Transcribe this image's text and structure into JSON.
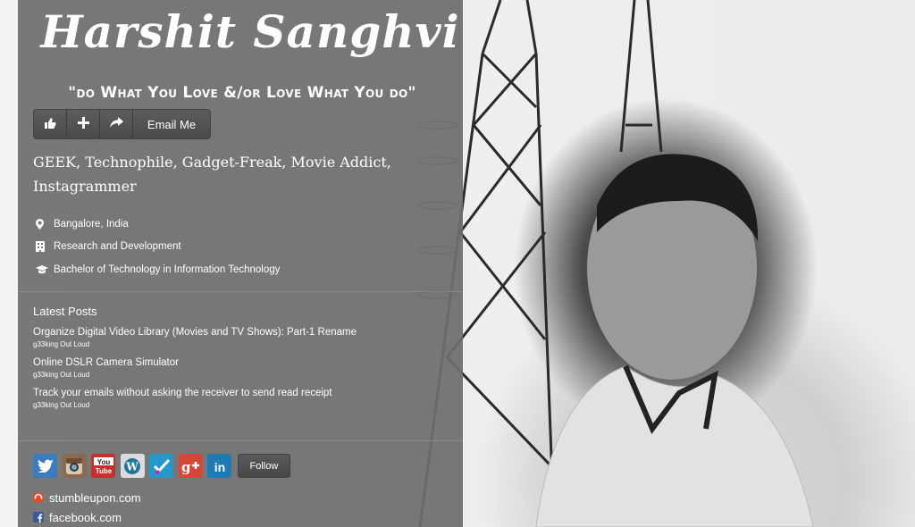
{
  "profile": {
    "name": "Harshit Sanghvi",
    "tagline": "\"do What You Love &/or Love What You do\"",
    "bio": "GEEK, Technophile, Gadget-Freak, Movie Addict, Instagrammer"
  },
  "actions": {
    "like_icon": "thumbs-up-icon",
    "add_icon": "plus-icon",
    "share_icon": "share-arrow-icon",
    "email_label": "Email Me"
  },
  "facts": [
    {
      "icon": "location-pin-icon",
      "text": "Bangalore, India"
    },
    {
      "icon": "building-icon",
      "text": "Research and Development"
    },
    {
      "icon": "graduation-cap-icon",
      "text": "Bachelor of Technology in Information Technology"
    }
  ],
  "latest_posts": {
    "heading": "Latest Posts",
    "items": [
      {
        "title": "Organize Digital Video Library (Movies and TV Shows): Part-1 Rename",
        "source": "g33king Out Loud"
      },
      {
        "title": "Online DSLR Camera Simulator",
        "source": "g33king Out Loud"
      },
      {
        "title": "Track your emails without asking the receiver to send read receipt",
        "source": "g33king Out Loud"
      }
    ]
  },
  "social": {
    "icons": [
      {
        "name": "twitter-icon",
        "glyph": "t",
        "color": "#3b7bbf"
      },
      {
        "name": "instagram-icon",
        "glyph": "◉",
        "color": "#8a6a4f"
      },
      {
        "name": "youtube-icon",
        "glyph": "You",
        "color": "#c4302b"
      },
      {
        "name": "wordpress-icon",
        "glyph": "W",
        "color": "#21759b"
      },
      {
        "name": "foursquare-icon",
        "glyph": "✔",
        "color": "#2398c9"
      },
      {
        "name": "google-plus-icon",
        "glyph": "g+",
        "color": "#d34836"
      },
      {
        "name": "linkedin-icon",
        "glyph": "in",
        "color": "#1f7bb6"
      }
    ],
    "follow_label": "Follow"
  },
  "links": [
    {
      "icon": "stumbleupon-icon",
      "text": "stumbleupon.com"
    },
    {
      "icon": "facebook-icon",
      "text": "facebook.com"
    }
  ],
  "colors": {
    "panel": "#6e6e6e",
    "text": "#ffffff"
  }
}
